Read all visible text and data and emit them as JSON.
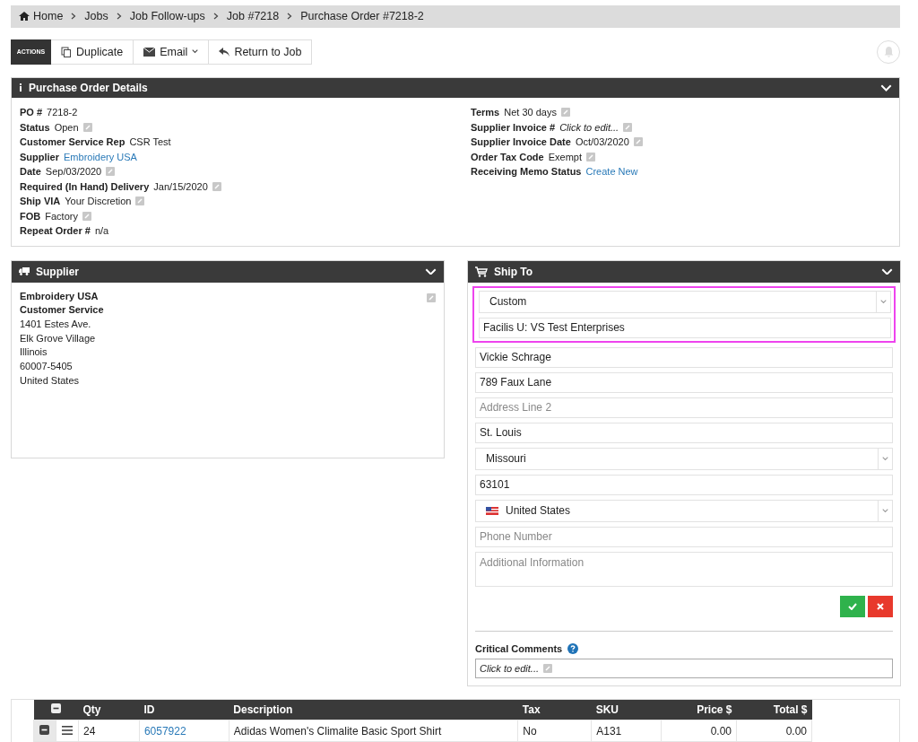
{
  "breadcrumb": [
    {
      "label": "Home",
      "kind": "home"
    },
    {
      "label": "Jobs",
      "kind": "plain"
    },
    {
      "label": "Job Follow-ups",
      "kind": "plain"
    },
    {
      "label": "Job #7218",
      "kind": "plain"
    },
    {
      "label": "Purchase Order #7218-2",
      "kind": "plain"
    }
  ],
  "actions": {
    "label": "ACTIONS",
    "buttons": [
      {
        "label": "Duplicate",
        "kind": "copy",
        "dropdown": false
      },
      {
        "label": "Email",
        "kind": "mail",
        "dropdown": true
      },
      {
        "label": "Return to Job",
        "kind": "reply",
        "dropdown": false
      }
    ]
  },
  "po_details": {
    "title": "Purchase Order Details",
    "left_fields": [
      {
        "label": "PO #",
        "value": "7218-2",
        "kind": "text",
        "editable": false
      },
      {
        "label": "Status",
        "value": "Open",
        "kind": "text",
        "editable": true
      },
      {
        "label": "Customer Service Rep",
        "value": "CSR Test",
        "kind": "text",
        "editable": false
      },
      {
        "label": "Supplier",
        "value": "Embroidery USA",
        "kind": "link",
        "editable": false
      },
      {
        "label": "Date",
        "value": "Sep/03/2020",
        "kind": "text",
        "editable": true
      },
      {
        "label": "Required (In Hand) Delivery",
        "value": "Jan/15/2020",
        "kind": "text",
        "editable": true
      },
      {
        "label": "Ship VIA",
        "value": "Your Discretion",
        "kind": "text",
        "editable": true
      },
      {
        "label": "FOB",
        "value": "Factory",
        "kind": "text",
        "editable": true
      },
      {
        "label": "Repeat Order #",
        "value": "n/a",
        "kind": "text",
        "editable": false
      }
    ],
    "right_fields": [
      {
        "label": "Terms",
        "value": "Net 30 days",
        "kind": "text",
        "editable": true
      },
      {
        "label": "Supplier Invoice #",
        "value": "Click to edit...",
        "kind": "placeholder",
        "editable": true
      },
      {
        "label": "Supplier Invoice Date",
        "value": "Oct/03/2020",
        "kind": "text",
        "editable": true
      },
      {
        "label": "Order Tax Code",
        "value": "Exempt",
        "kind": "text",
        "editable": true
      },
      {
        "label": "Receiving Memo Status",
        "value": "Create New",
        "kind": "link",
        "editable": false
      }
    ]
  },
  "supplier": {
    "title": "Supplier",
    "editable": true,
    "lines": [
      {
        "text": "Embroidery USA",
        "bold": true
      },
      {
        "text": "Customer Service",
        "bold": true
      },
      {
        "text": "1401 Estes Ave.",
        "bold": false
      },
      {
        "text": "Elk Grove Village",
        "bold": false
      },
      {
        "text": "Illinois",
        "bold": false
      },
      {
        "text": "60007-5405",
        "bold": false
      },
      {
        "text": "United States",
        "bold": false
      }
    ]
  },
  "ship_to": {
    "title": "Ship To",
    "fields": [
      {
        "kind": "select",
        "value": "Custom",
        "highlighted": true,
        "flag": false
      },
      {
        "kind": "input",
        "value": "Facilis U: VS Test Enterprises",
        "highlighted": true
      },
      {
        "kind": "input",
        "value": "Vickie Schrage",
        "highlighted": false
      },
      {
        "kind": "input",
        "value": "789 Faux Lane",
        "highlighted": false
      },
      {
        "kind": "input",
        "placeholder": "Address Line 2",
        "highlighted": false
      },
      {
        "kind": "input",
        "value": "St. Louis",
        "highlighted": false
      },
      {
        "kind": "select",
        "value": "Missouri",
        "highlighted": false,
        "flag": false
      },
      {
        "kind": "input",
        "value": "63101",
        "highlighted": false
      },
      {
        "kind": "select",
        "value": "United States",
        "highlighted": false,
        "flag": true
      },
      {
        "kind": "input",
        "placeholder": "Phone Number",
        "highlighted": false
      },
      {
        "kind": "textarea",
        "placeholder": "Additional Information",
        "highlighted": false
      }
    ],
    "critical_comments": {
      "label": "Critical Comments",
      "value": "Click to edit..."
    }
  },
  "table": {
    "columns": [
      "Qty",
      "ID",
      "Description",
      "Tax",
      "SKU",
      "Price $",
      "Total $"
    ],
    "rows": [
      {
        "qty": "24",
        "id": "6057922",
        "description": "Adidas Women's Climalite Basic Sport Shirt",
        "tax": "No",
        "sku": "A131",
        "price": "0.00",
        "total": "0.00"
      }
    ]
  }
}
